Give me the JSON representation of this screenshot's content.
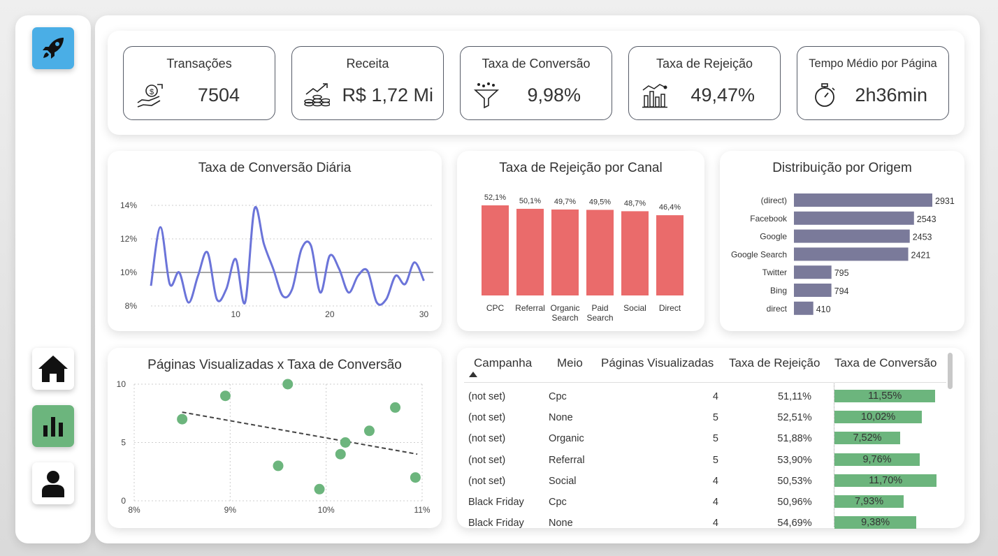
{
  "nav": {
    "logo_icon": "rocket-icon",
    "items": [
      {
        "icon": "home-icon",
        "active": false
      },
      {
        "icon": "bar-chart-icon",
        "active": true
      },
      {
        "icon": "user-icon",
        "active": false
      }
    ]
  },
  "kpis": [
    {
      "title": "Transações",
      "value": "7504",
      "icon": "money-hand-icon"
    },
    {
      "title": "Receita",
      "value": "R$ 1,72 Mi",
      "icon": "revenue-growth-icon"
    },
    {
      "title": "Taxa de Conversão",
      "value": "9,98%",
      "icon": "funnel-icon"
    },
    {
      "title": "Taxa de Rejeição",
      "value": "49,47%",
      "icon": "bar-chart-line-icon"
    },
    {
      "title": "Tempo Médio por Página",
      "value": "2h36min",
      "icon": "stopwatch-icon"
    }
  ],
  "colors": {
    "accent": "#4aaee6",
    "green": "#6cb57d",
    "line": "#6b74d9",
    "red": "#ea6b6b",
    "purple": "#7a7a9a"
  },
  "chart_data": [
    {
      "type": "line",
      "title": "Taxa de Conversão Diária",
      "x": [
        1,
        2,
        3,
        4,
        5,
        6,
        7,
        8,
        9,
        10,
        11,
        12,
        13,
        14,
        15,
        16,
        17,
        18,
        19,
        20,
        21,
        22,
        23,
        24,
        25,
        26,
        27,
        28,
        29,
        30,
        31
      ],
      "y": [
        9.2,
        12.7,
        9.3,
        10.0,
        8.2,
        9.8,
        11.2,
        8.4,
        9.0,
        10.8,
        8.2,
        13.8,
        11.7,
        10.2,
        8.6,
        9.0,
        11.4,
        11.6,
        8.8,
        11.0,
        10.2,
        8.8,
        9.8,
        10.1,
        8.2,
        8.4,
        9.8,
        9.3,
        10.6,
        9.5
      ],
      "xticks": [
        "10",
        "20",
        "30"
      ],
      "yticks": [
        "14%",
        "12%",
        "10%",
        "8%"
      ],
      "reference_line": 10,
      "ylim": [
        8,
        14
      ]
    },
    {
      "type": "bar",
      "title": "Taxa de Rejeição por Canal",
      "categories": [
        "CPC",
        "Referral",
        "Organic Search",
        "Paid Search",
        "Social",
        "Direct"
      ],
      "values": [
        52.1,
        50.1,
        49.7,
        49.5,
        48.7,
        46.4
      ],
      "labels": [
        "52,1%",
        "50,1%",
        "49,7%",
        "49,5%",
        "48,7%",
        "46,4%"
      ]
    },
    {
      "type": "bar",
      "orientation": "horizontal",
      "title": "Distribuição por Origem",
      "categories": [
        "(direct)",
        "Facebook",
        "Google",
        "Google Search",
        "Twitter",
        "Bing",
        "direct"
      ],
      "values": [
        2931,
        2543,
        2453,
        2421,
        795,
        794,
        410
      ]
    },
    {
      "type": "scatter",
      "title": "Páginas Visualizadas x Taxa de Conversão",
      "x": [
        8.5,
        8.95,
        9.6,
        9.5,
        9.93,
        10.15,
        10.2,
        10.45,
        10.72,
        10.93
      ],
      "y": [
        7,
        9,
        10,
        3,
        1,
        4,
        5,
        6,
        8,
        2
      ],
      "xticks": [
        "8%",
        "9%",
        "10%",
        "11%"
      ],
      "yticks": [
        "10",
        "5",
        "0"
      ],
      "xlim": [
        8,
        11
      ],
      "ylim": [
        0,
        10
      ],
      "trendline": {
        "x": [
          8.5,
          10.95
        ],
        "y": [
          7.6,
          4.0
        ]
      }
    },
    {
      "type": "table",
      "columns": [
        "Campanha",
        "Meio",
        "Páginas Visualizadas",
        "Taxa de Rejeição",
        "Taxa de Conversão"
      ],
      "rows": [
        {
          "campanha": "(not set)",
          "meio": "Cpc",
          "paginas": "4",
          "rejeicao": "51,11%",
          "conversao": "11,55%",
          "conv_val": 11.55
        },
        {
          "campanha": "(not set)",
          "meio": "None",
          "paginas": "5",
          "rejeicao": "52,51%",
          "conversao": "10,02%",
          "conv_val": 10.02
        },
        {
          "campanha": "(not set)",
          "meio": "Organic",
          "paginas": "5",
          "rejeicao": "51,88%",
          "conversao": "7,52%",
          "conv_val": 7.52
        },
        {
          "campanha": "(not set)",
          "meio": "Referral",
          "paginas": "5",
          "rejeicao": "53,90%",
          "conversao": "9,76%",
          "conv_val": 9.76
        },
        {
          "campanha": "(not set)",
          "meio": "Social",
          "paginas": "4",
          "rejeicao": "50,53%",
          "conversao": "11,70%",
          "conv_val": 11.7
        },
        {
          "campanha": "Black Friday",
          "meio": "Cpc",
          "paginas": "4",
          "rejeicao": "50,96%",
          "conversao": "7,93%",
          "conv_val": 7.93
        },
        {
          "campanha": "Black Friday",
          "meio": "None",
          "paginas": "4",
          "rejeicao": "54,69%",
          "conversao": "9,38%",
          "conv_val": 9.38
        }
      ]
    }
  ]
}
